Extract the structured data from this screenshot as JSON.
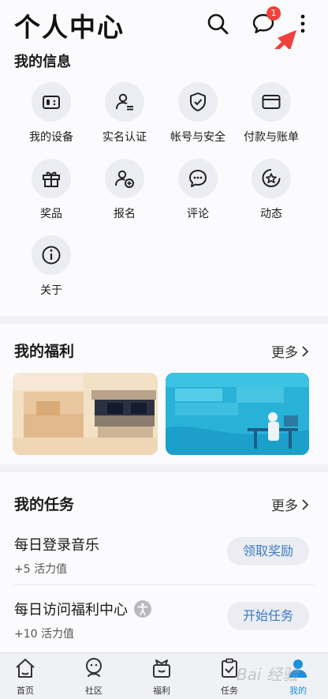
{
  "header": {
    "title": "个人中心",
    "message_badge": "1"
  },
  "my_info": {
    "title": "我的信息",
    "items": [
      {
        "label": "我的设备",
        "icon": "device-icon"
      },
      {
        "label": "实名认证",
        "icon": "id-card-icon"
      },
      {
        "label": "帐号与安全",
        "icon": "shield-icon"
      },
      {
        "label": "付款与账单",
        "icon": "card-icon"
      },
      {
        "label": "奖品",
        "icon": "gift-icon"
      },
      {
        "label": "报名",
        "icon": "add-user-icon"
      },
      {
        "label": "评论",
        "icon": "comment-icon"
      },
      {
        "label": "动态",
        "icon": "star-icon"
      },
      {
        "label": "关于",
        "icon": "info-icon"
      }
    ]
  },
  "welfare": {
    "title": "我的福利",
    "more": "更多"
  },
  "tasks": {
    "title": "我的任务",
    "more": "更多",
    "items": [
      {
        "name": "每日登录音乐",
        "reward": "+5 活力值",
        "button": "领取奖励"
      },
      {
        "name": "每日访问福利中心",
        "reward": "+10 活力值",
        "button": "开始任务"
      }
    ]
  },
  "tabbar": {
    "items": [
      {
        "label": "首页",
        "icon": "home-icon"
      },
      {
        "label": "社区",
        "icon": "community-icon"
      },
      {
        "label": "福利",
        "icon": "gift-box-icon"
      },
      {
        "label": "任务",
        "icon": "task-icon"
      },
      {
        "label": "我的",
        "icon": "profile-icon",
        "active": true
      }
    ]
  },
  "watermark": "Bai 经验",
  "colors": {
    "accent": "#1a8fe0",
    "badge": "#f2413b",
    "arrow": "#f0413c",
    "button_text": "#3b7ac9"
  }
}
